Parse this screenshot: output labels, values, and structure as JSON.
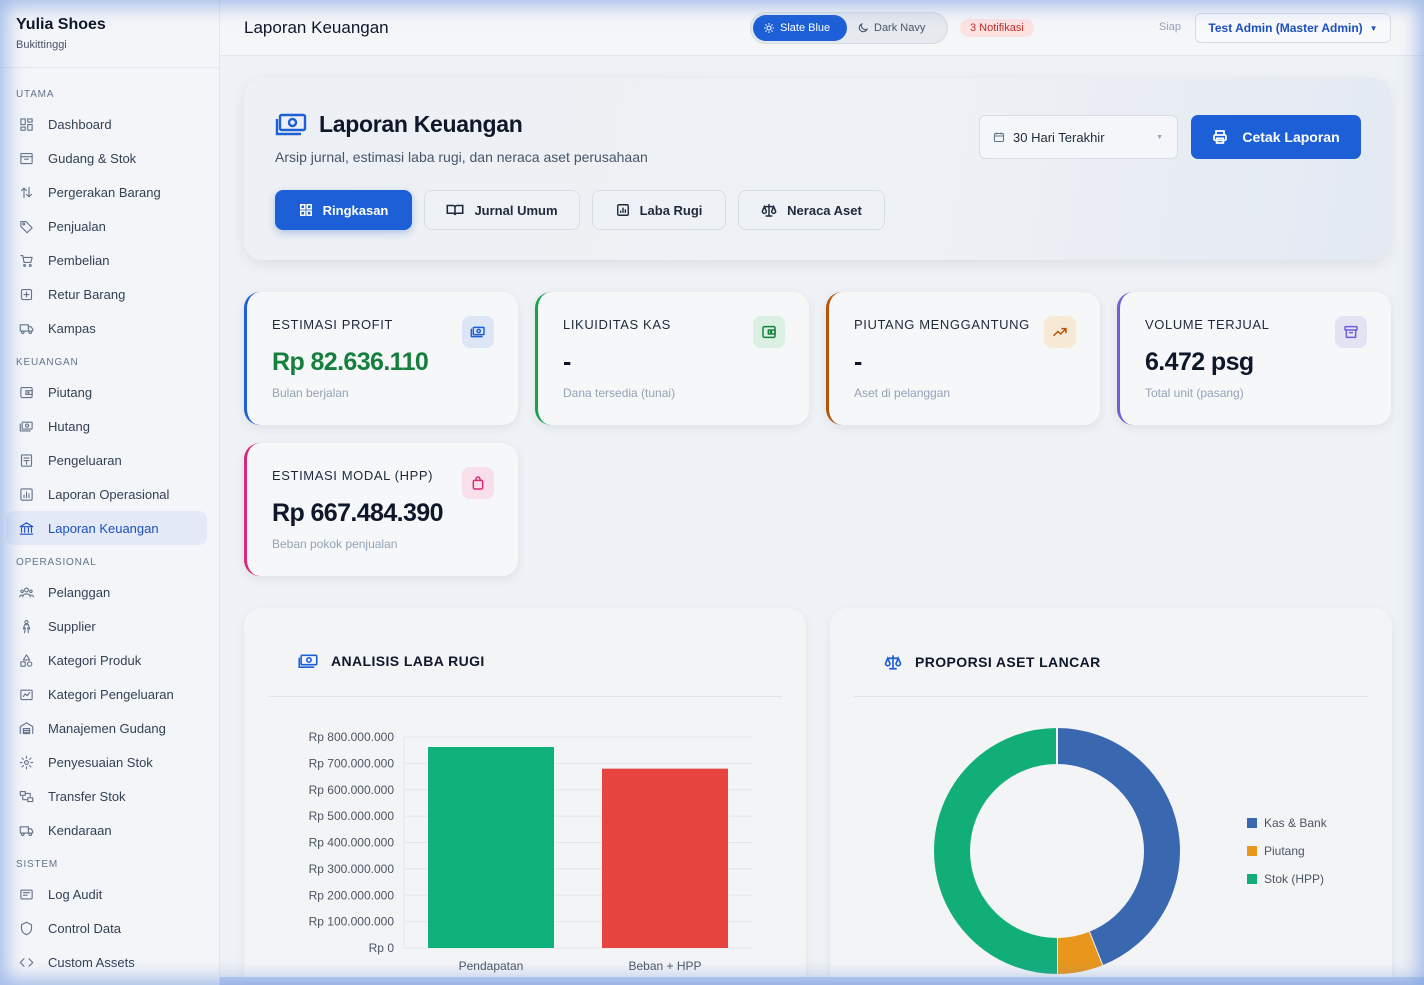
{
  "brand": {
    "name": "Yulia Shoes",
    "subtitle": "Bukittinggi"
  },
  "sidebar": {
    "sections": [
      {
        "title": "UTAMA",
        "items": [
          {
            "label": "Dashboard",
            "icon": "dashboard-icon"
          },
          {
            "label": "Gudang & Stok",
            "icon": "box-icon"
          },
          {
            "label": "Pergerakan Barang",
            "icon": "arrows-icon"
          },
          {
            "label": "Penjualan",
            "icon": "tag-icon"
          },
          {
            "label": "Pembelian",
            "icon": "cart-icon"
          },
          {
            "label": "Retur Barang",
            "icon": "return-icon"
          },
          {
            "label": "Kampas",
            "icon": "truck-icon"
          }
        ]
      },
      {
        "title": "KEUANGAN",
        "items": [
          {
            "label": "Piutang",
            "icon": "wallet-icon"
          },
          {
            "label": "Hutang",
            "icon": "money-icon"
          },
          {
            "label": "Pengeluaran",
            "icon": "receipt-icon"
          },
          {
            "label": "Laporan Operasional",
            "icon": "report-icon"
          },
          {
            "label": "Laporan Keuangan",
            "icon": "bank-icon",
            "active": true
          }
        ]
      },
      {
        "title": "OPERASIONAL",
        "items": [
          {
            "label": "Pelanggan",
            "icon": "users-icon"
          },
          {
            "label": "Supplier",
            "icon": "person-icon"
          },
          {
            "label": "Kategori Produk",
            "icon": "shapes-icon"
          },
          {
            "label": "Kategori Pengeluaran",
            "icon": "folder-icon"
          },
          {
            "label": "Manajemen Gudang",
            "icon": "warehouse-icon"
          },
          {
            "label": "Penyesuaian Stok",
            "icon": "cog-icon"
          },
          {
            "label": "Transfer Stok",
            "icon": "transfer-icon"
          },
          {
            "label": "Kendaraan",
            "icon": "truck-icon"
          }
        ]
      },
      {
        "title": "SISTEM",
        "items": [
          {
            "label": "Log Audit",
            "icon": "log-icon"
          },
          {
            "label": "Control Data",
            "icon": "shield-icon"
          },
          {
            "label": "Custom Assets",
            "icon": "code-icon"
          }
        ]
      }
    ]
  },
  "topbar": {
    "title": "Laporan Keuangan",
    "theme_light": "Slate Blue",
    "theme_dark": "Dark Navy",
    "notifications": "3 Notifikasi",
    "status": "Siap",
    "user": "Test Admin (Master Admin)"
  },
  "hero": {
    "title": "Laporan Keuangan",
    "subtitle": "Arsip jurnal, estimasi laba rugi, dan neraca aset perusahaan",
    "period": "30 Hari Terakhir",
    "print_label": "Cetak Laporan",
    "tabs": [
      "Ringkasan",
      "Jurnal Umum",
      "Laba Rugi",
      "Neraca Aset"
    ]
  },
  "cards": [
    {
      "label": "ESTIMASI PROFIT",
      "value": "Rp 82.636.110",
      "note": "Bulan berjalan",
      "accent": "#1d5fd6",
      "value_color": "#15803d",
      "icon": "money-icon",
      "icon_bg": "#dde6f7",
      "icon_color": "#1d5fd6"
    },
    {
      "label": "LIKUIDITAS KAS",
      "value": "-",
      "note": "Dana tersedia (tunai)",
      "accent": "#16a34a",
      "value_color": "#0f172a",
      "icon": "wallet-icon",
      "icon_bg": "#dcefe3",
      "icon_color": "#15803d"
    },
    {
      "label": "PIUTANG MENGGANTUNG",
      "value": "-",
      "note": "Aset di pelanggan",
      "accent": "#b45309",
      "value_color": "#0f172a",
      "icon": "trend-up-icon",
      "icon_bg": "#f6ead7",
      "icon_color": "#b45309"
    },
    {
      "label": "VOLUME TERJUAL",
      "value": "6.472 psg",
      "note": "Total unit (pasang)",
      "accent": "#6d5fd6",
      "value_color": "#0f172a",
      "icon": "archive-icon",
      "icon_bg": "#e4e3f6",
      "icon_color": "#6d5fd6"
    },
    {
      "label": "ESTIMASI MODAL (HPP)",
      "value": "Rp 667.484.390",
      "note": "Beban pokok penjualan",
      "accent": "#db2777",
      "value_color": "#0f172a",
      "icon": "bag-icon",
      "icon_bg": "#f8dfe9",
      "icon_color": "#db2777"
    }
  ],
  "panels": {
    "profit_title": "ANALISIS LABA RUGI",
    "assets_title": "PROPORSI ASET LANCAR"
  },
  "chart_data": [
    {
      "type": "bar",
      "title": "ANALISIS LABA RUGI",
      "categories": [
        "Pendapatan",
        "Beban + HPP"
      ],
      "values": [
        762000000,
        680000000
      ],
      "colors": [
        "#10b07a",
        "#e5443f"
      ],
      "ylim": [
        0,
        800000000
      ],
      "yticks": [
        "Rp 0",
        "Rp 100.000.000",
        "Rp 200.000.000",
        "Rp 300.000.000",
        "Rp 400.000.000",
        "Rp 500.000.000",
        "Rp 600.000.000",
        "Rp 700.000.000",
        "Rp 800.000.000"
      ],
      "grid": true
    },
    {
      "type": "pie",
      "title": "PROPORSI ASET LANCAR",
      "labels": [
        "Kas & Bank",
        "Piutang",
        "Stok (HPP)"
      ],
      "values": [
        44,
        6,
        50
      ],
      "colors": [
        "#3a68b0",
        "#e8961c",
        "#12ae78"
      ],
      "donut": true,
      "legend": "right"
    }
  ]
}
